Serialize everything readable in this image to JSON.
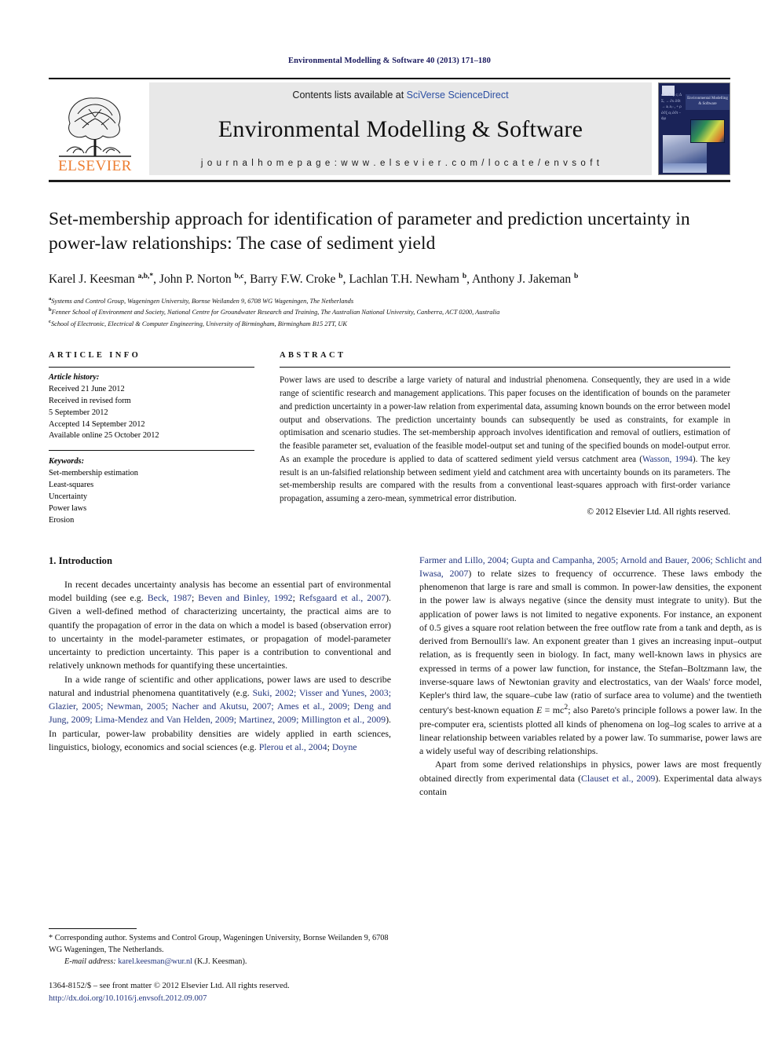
{
  "running_head": "Environmental Modelling & Software 40 (2013) 171–180",
  "masthead": {
    "publisher_name": "ELSEVIER",
    "contents_prefix": "Contents lists available at ",
    "contents_link": "SciVerse ScienceDirect",
    "journal_name": "Environmental Modelling & Software",
    "homepage": "j o u r n a l   h o m e p a g e :   w w w . e l s e v i e r . c o m / l o c a t e / e n v s o f t",
    "cover_title": "Environmental Modelling & Software",
    "cover_equations": "∂C ⁄ ∂t  γᵢ cⱼ Δ Σᵢ → ∂x ∂⁄∂t → aᵢ aᵢ₋₁ + ρ ∂⁄∂ξ αⱼ ∂⁄∂t − dⱼφ"
  },
  "article": {
    "title": "Set-membership approach for identification of parameter and prediction uncertainty in power-law relationships: The case of sediment yield",
    "authors_html": "Karel J. Keesman <sup>a,b,</sup><sup>*</sup>, John P. Norton <sup>b,c</sup>, Barry F.W. Croke <sup>b</sup>, Lachlan T.H. Newham <sup>b</sup>, Anthony J. Jakeman <sup>b</sup>",
    "affiliations": [
      {
        "marker": "a",
        "text": "Systems and Control Group, Wageningen University, Bornse Weilanden 9, 6708 WG Wageningen, The Netherlands"
      },
      {
        "marker": "b",
        "text": "Fenner School of Environment and Society, National Centre for Groundwater Research and Training, The Australian National University, Canberra, ACT 0200, Australia"
      },
      {
        "marker": "c",
        "text": "School of Electronic, Electrical & Computer Engineering, University of Birmingham, Birmingham B15 2TT, UK"
      }
    ]
  },
  "article_info": {
    "heading": "ARTICLE INFO",
    "history_label": "Article history:",
    "history_lines": [
      "Received 21 June 2012",
      "Received in revised form",
      "5 September 2012",
      "Accepted 14 September 2012",
      "Available online 25 October 2012"
    ],
    "keywords_label": "Keywords:",
    "keywords": [
      "Set-membership estimation",
      "Least-squares",
      "Uncertainty",
      "Power laws",
      "Erosion"
    ]
  },
  "abstract": {
    "heading": "ABSTRACT",
    "part1": "Power laws are used to describe a large variety of natural and industrial phenomena. Consequently, they are used in a wide range of scientific research and management applications. This paper focuses on the identification of bounds on the parameter and prediction uncertainty in a power-law relation from experimental data, assuming known bounds on the error between model output and observations. The prediction uncertainty bounds can subsequently be used as constraints, for example in optimisation and scenario studies. The set-membership approach involves identification and removal of outliers, estimation of the feasible parameter set, evaluation of the feasible model-output set and tuning of the specified bounds on model-output error. As an example the procedure is applied to data of scattered sediment yield versus catchment area (",
    "ref1": "Wasson, 1994",
    "part2": "). The key result is an un-falsified relationship between sediment yield and catchment area with uncertainty bounds on its parameters. The set-membership results are compared with the results from a conventional least-squares approach with first-order variance propagation, assuming a zero-mean, symmetrical error distribution.",
    "copyright": "© 2012 Elsevier Ltd. All rights reserved."
  },
  "body": {
    "section_title": "1. Introduction",
    "left": {
      "p1_a": "In recent decades uncertainty analysis has become an essential part of environmental model building (see e.g. ",
      "p1_r1": "Beck, 1987",
      "p1_b": "; ",
      "p1_r2": "Beven and Binley, 1992",
      "p1_c": "; ",
      "p1_r3": "Refsgaard et al., 2007",
      "p1_d": "). Given a well-defined method of characterizing uncertainty, the practical aims are to quantify the propagation of error in the data on which a model is based (observation error) to uncertainty in the model-parameter estimates, or propagation of model-parameter uncertainty to prediction uncertainty. This paper is a contribution to conventional and relatively unknown methods for quantifying these uncertainties.",
      "p2_a": "In a wide range of scientific and other applications, power laws are used to describe natural and industrial phenomena quantitatively (e.g. ",
      "p2_refs": "Suki, 2002; Visser and Yunes, 2003; Glazier, 2005; Newman, 2005; Nacher and Akutsu, 2007; Ames et al., 2009; Deng and Jung, 2009; Lima-Mendez and Van Helden, 2009; Martinez, 2009; Millington et al., 2009",
      "p2_b": "). In particular, power-law probability densities are widely applied in earth sciences, linguistics, biology, economics and social sciences (e.g. ",
      "p2_r2": "Plerou et al., 2004",
      "p2_c": "; ",
      "p2_r3": "Doyne"
    },
    "right": {
      "p1_refs": "Farmer and Lillo, 2004; Gupta and Campanha, 2005; Arnold and Bauer, 2006; Schlicht and Iwasa, 2007",
      "p1_a": ") to relate sizes to frequency of occurrence. These laws embody the phenomenon that large is rare and small is common. In power-law densities, the exponent in the power law is always negative (since the density must integrate to unity). But the application of power laws is not limited to negative exponents. For instance, an exponent of 0.5 gives a square root relation between the free outflow rate from a tank and depth, as is derived from Bernoulli's law. An exponent greater than 1 gives an increasing input–output relation, as is frequently seen in biology. In fact, many well-known laws in physics are expressed in terms of a power law function, for instance, the Stefan–Boltzmann law, the inverse-square laws of Newtonian gravity and electrostatics, van der Waals' force model, Kepler's third law, the square–cube law (ratio of surface area to volume) and the twentieth century's best-known equation ",
      "p1_eq_e": "E",
      "p1_eq_mid": " = mc",
      "p1_eq_sup": "2",
      "p1_b": "; also Pareto's principle follows a power law. In the pre-computer era, scientists plotted all kinds of phenomena on log–log scales to arrive at a linear relationship between variables related by a power law. To summarise, power laws are a widely useful way of describing relationships.",
      "p2_a": "Apart from some derived relationships in physics, power laws are most frequently obtained directly from experimental data (",
      "p2_ref": "Clauset et al., 2009",
      "p2_b": "). Experimental data always contain"
    }
  },
  "footnotes": {
    "corresponding": "* Corresponding author. Systems and Control Group, Wageningen University, Bornse Weilanden 9, 6708 WG Wageningen, The Netherlands.",
    "email_label": "E-mail address:",
    "email": "karel.keesman@wur.nl",
    "email_suffix": " (K.J. Keesman).",
    "issn_line": "1364-8152/$ – see front matter © 2012 Elsevier Ltd. All rights reserved.",
    "doi": "http://dx.doi.org/10.1016/j.envsoft.2012.09.007"
  },
  "colors": {
    "link": "#22357e",
    "running_head": "#1a1a5e",
    "elsevier_orange": "#ED7D31",
    "band_gray": "#e8e8e8"
  }
}
